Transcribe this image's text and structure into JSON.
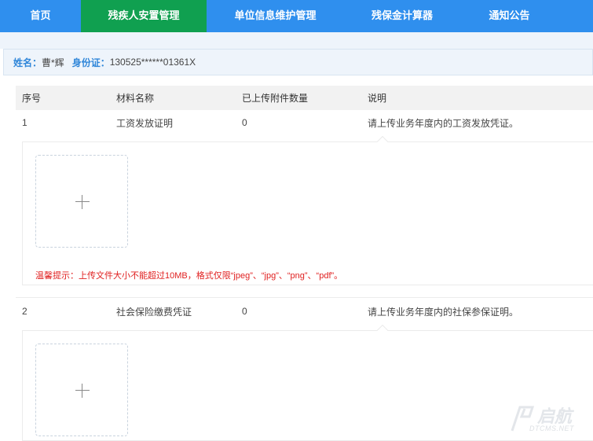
{
  "nav": {
    "items": [
      {
        "label": "首页"
      },
      {
        "label": "残疾人安置管理"
      },
      {
        "label": "单位信息维护管理"
      },
      {
        "label": "残保金计算器"
      },
      {
        "label": "通知公告"
      }
    ]
  },
  "user": {
    "name_label": "姓名：",
    "name_value": "曹*辉",
    "id_label": "身份证：",
    "id_value": "130525******01361X"
  },
  "table": {
    "headers": {
      "seq": "序号",
      "material": "材料名称",
      "count": "已上传附件数量",
      "desc": "说明"
    },
    "rows": [
      {
        "seq": "1",
        "material": "工资发放证明",
        "count": "0",
        "desc": "请上传业务年度内的工资发放凭证。"
      },
      {
        "seq": "2",
        "material": "社会保险缴费凭证",
        "count": "0",
        "desc": "请上传业务年度内的社保参保证明。"
      }
    ]
  },
  "upload": {
    "tip": "温馨提示：上传文件大小不能超过10MB，格式仅限“jpeg”、“jpg”、“png”、“pdf”。"
  },
  "watermark": {
    "text": "启航",
    "sub": "DTCMS.NET"
  }
}
